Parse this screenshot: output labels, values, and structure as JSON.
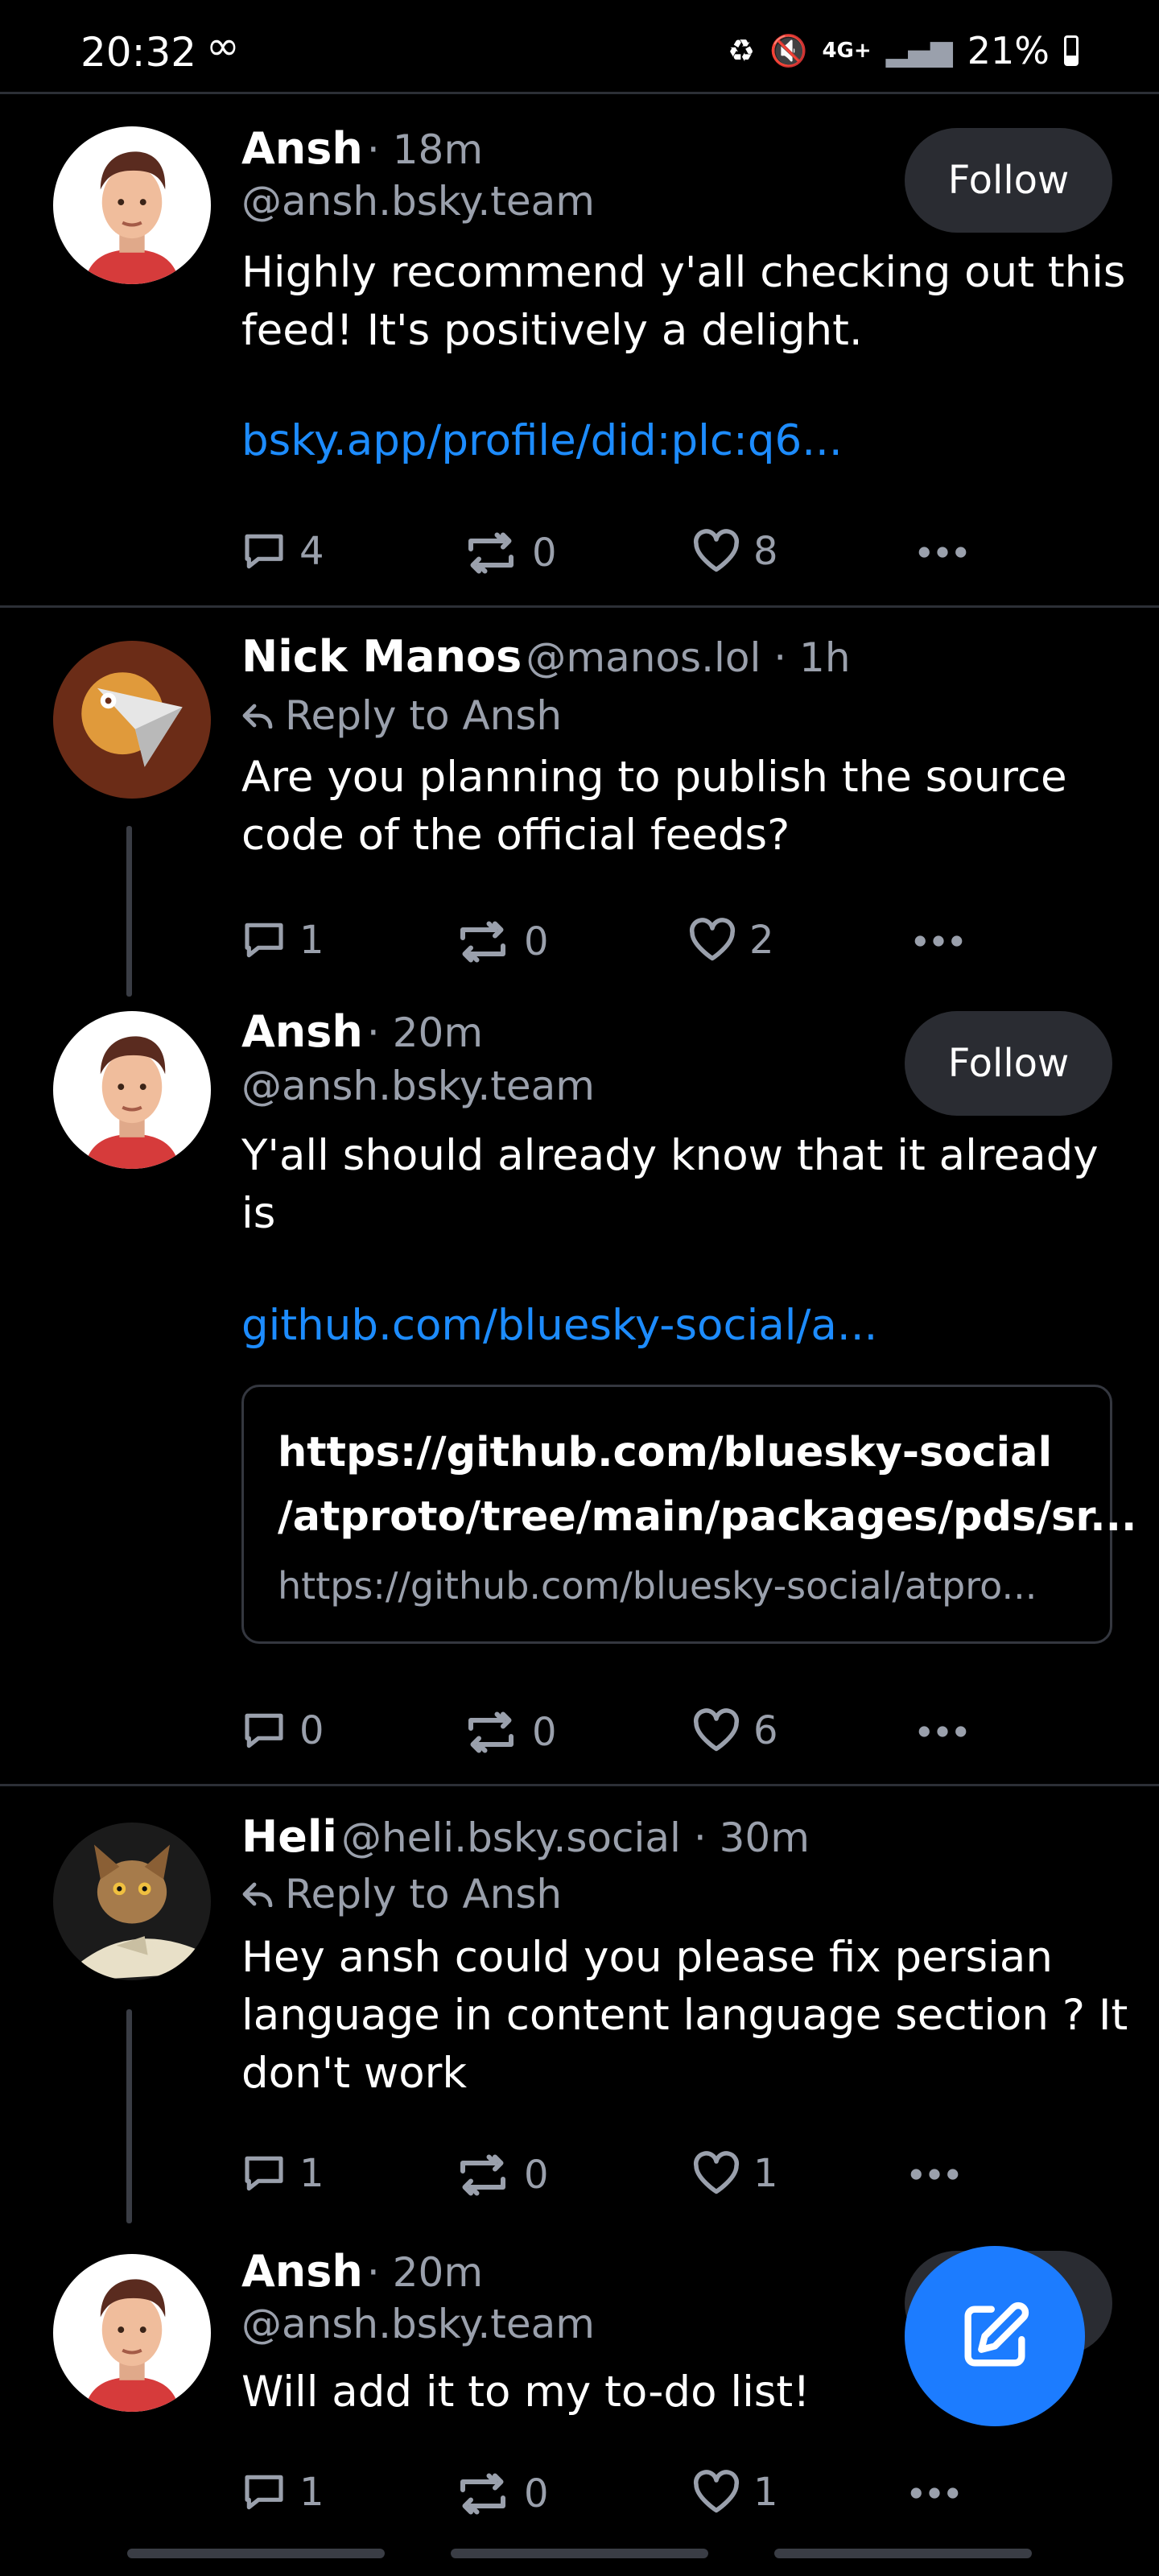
{
  "status_bar": {
    "time": "20:32",
    "infinity": "∞",
    "network": "4G+",
    "battery": "21%"
  },
  "posts": [
    {
      "author": "Ansh",
      "meta": "· 18m",
      "handle": "@ansh.bsky.team",
      "follow_label": "Follow",
      "text_line1": "Highly recommend y'all checking out this",
      "text_line2": "feed! It's positively a delight.",
      "link": "bsky.app/profile/did:plc:q6...",
      "replies": "4",
      "reposts": "0",
      "likes": "8"
    },
    {
      "author": "Nick Manos",
      "meta": "@manos.lol · 1h",
      "reply_to": "Reply to Ansh",
      "text_line1": "Are you planning to publish the source",
      "text_line2": "code of the official feeds?",
      "replies": "1",
      "reposts": "0",
      "likes": "2"
    },
    {
      "author": "Ansh",
      "meta": "· 20m",
      "handle": "@ansh.bsky.team",
      "follow_label": "Follow",
      "text_line1": "Y'all should already know that it already",
      "text_line2": "is",
      "link": "github.com/bluesky-social/a...",
      "card_title_line1": "https://github.com/bluesky-social",
      "card_title_line2": "/atproto/tree/main/packages/pds/sr...",
      "card_url": "https://github.com/bluesky-social/atpro...",
      "replies": "0",
      "reposts": "0",
      "likes": "6"
    },
    {
      "author": "Heli",
      "meta": "@heli.bsky.social · 30m",
      "reply_to": "Reply to Ansh",
      "text_line1": "Hey ansh could you please fix persian",
      "text_line2": "language in content language section ? It",
      "text_line3": "don't work",
      "replies": "1",
      "reposts": "0",
      "likes": "1"
    },
    {
      "author": "Ansh",
      "meta": "· 20m",
      "handle": "@ansh.bsky.team",
      "text_line1": "Will add it to my to-do list!",
      "replies": "1",
      "reposts": "0",
      "likes": "1"
    }
  ],
  "icons": {
    "reply": "speech-bubble-icon",
    "repost": "repost-arrows-icon",
    "like": "heart-icon",
    "more": "ellipsis-icon",
    "compose": "compose-pencil-icon"
  },
  "colors": {
    "background": "#000000",
    "link": "#1d8cff",
    "muted": "#9aa0ac",
    "fab": "#1c7cff"
  }
}
